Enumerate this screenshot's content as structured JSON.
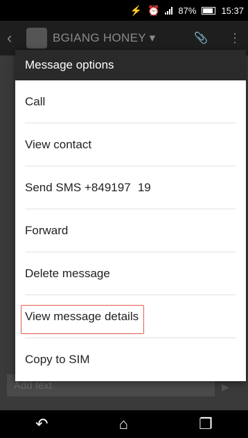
{
  "status_bar": {
    "battery_percent": "87%",
    "time": "15:37",
    "icons": [
      "no-charge-icon",
      "alarm-icon",
      "signal-icon",
      "battery-icon"
    ]
  },
  "header": {
    "contact_name": "BGIANG HONEY ▾",
    "icons": [
      "back-icon",
      "avatar",
      "paperclip-icon",
      "more-icon"
    ]
  },
  "dialog": {
    "title": "Message options",
    "items": [
      {
        "label": "Call"
      },
      {
        "label": "View contact"
      },
      {
        "label": "Send SMS +849197   19"
      },
      {
        "label": "Forward"
      },
      {
        "label": "Delete message"
      },
      {
        "label": "View message details"
      },
      {
        "label": "Copy to SIM"
      }
    ]
  },
  "compose": {
    "placeholder": "Add text"
  },
  "nav": {
    "icons": [
      "back-nav-icon",
      "home-icon",
      "recents-icon"
    ]
  }
}
